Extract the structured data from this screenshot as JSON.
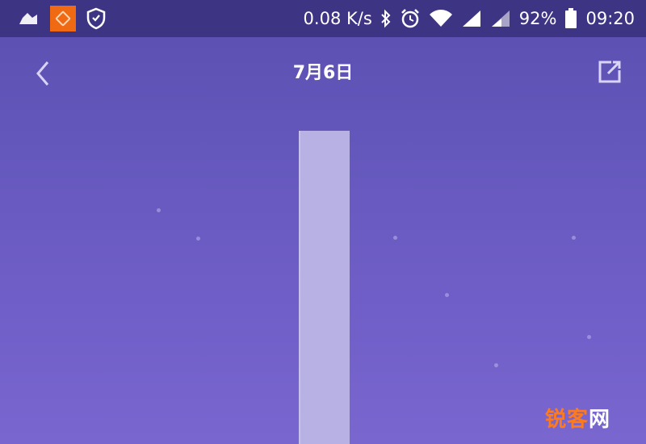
{
  "status_bar": {
    "network_speed": "0.08 K/s",
    "battery": "92%",
    "time": "09:20",
    "icons": [
      "cloud-icon",
      "app-notification-icon",
      "shield-icon",
      "bluetooth-icon",
      "alarm-icon",
      "wifi-icon",
      "signal-icon",
      "signal-icon-2",
      "battery-icon"
    ]
  },
  "header": {
    "title": "7月6日",
    "back_icon": "chevron-left-icon",
    "share_icon": "share-icon"
  },
  "chart_data": {
    "type": "bar",
    "values": [
      1
    ]
  },
  "watermark": {
    "part1": "锐客",
    "part2": "网"
  },
  "colors": {
    "status_bar": "#3d3583",
    "background_top": "#5a4fb0",
    "background_bottom": "#7a66cf",
    "bar": "#b8b2e4",
    "watermark_accent": "#ff7a1a"
  }
}
